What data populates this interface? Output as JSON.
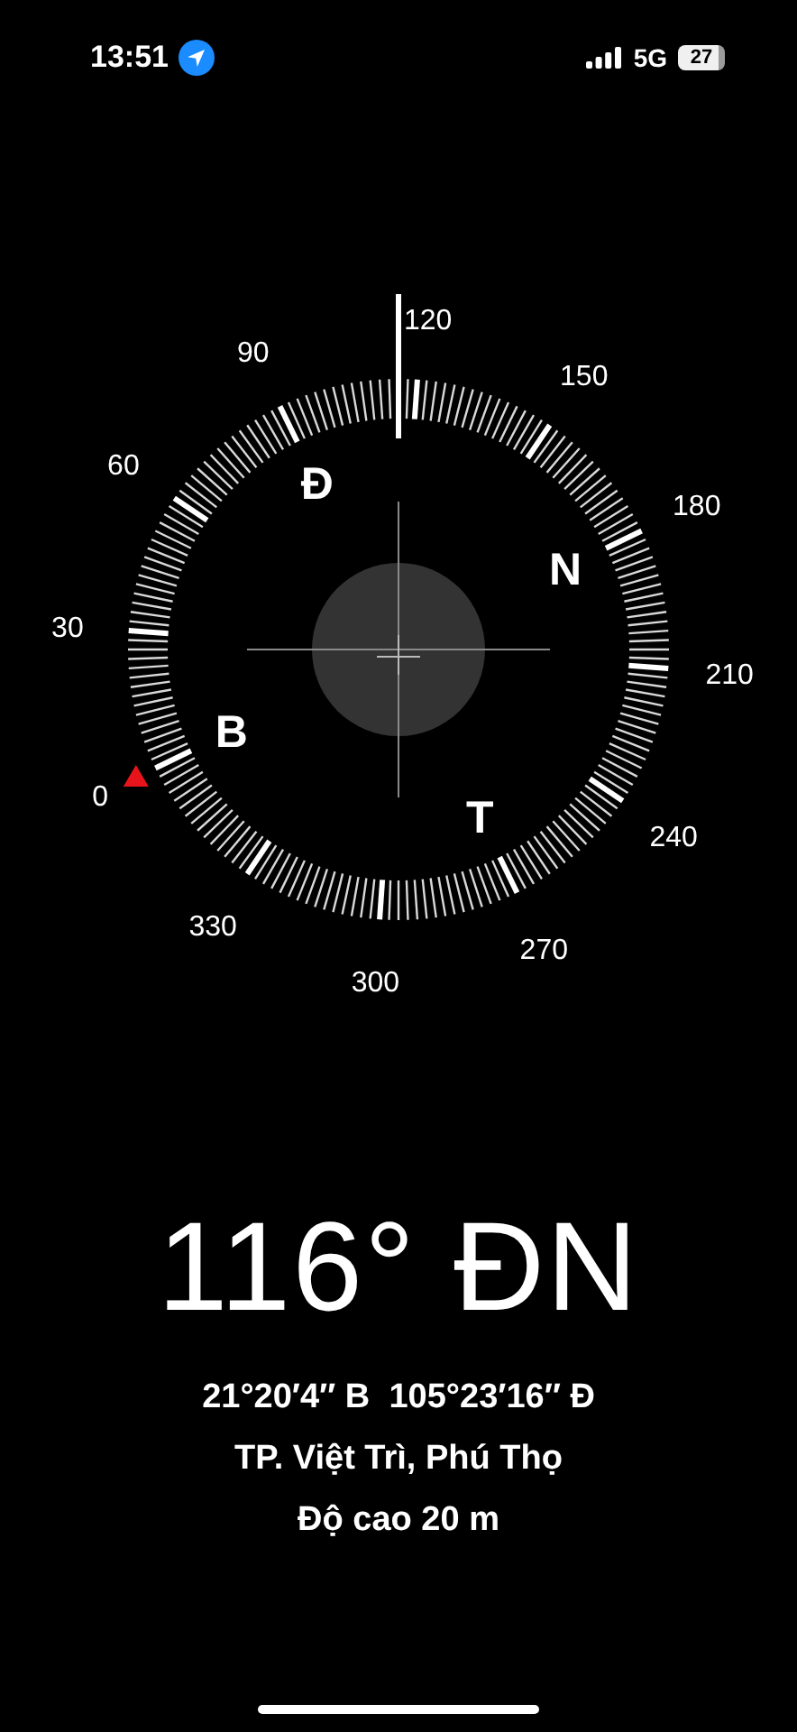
{
  "status_bar": {
    "time": "13:51",
    "network": "5G",
    "battery": "27"
  },
  "compass": {
    "degree_labels": [
      "0",
      "30",
      "60",
      "90",
      "120",
      "150",
      "180",
      "210",
      "240",
      "270",
      "300",
      "330"
    ],
    "cardinal_labels": [
      "B",
      "Đ",
      "N",
      "T"
    ]
  },
  "heading": "116° ĐN",
  "coordinates": "21°20′4″ B  105°23′16″ Đ",
  "place": "TP. Việt Trì, Phú Thọ",
  "elevation": "Độ cao 20 m"
}
